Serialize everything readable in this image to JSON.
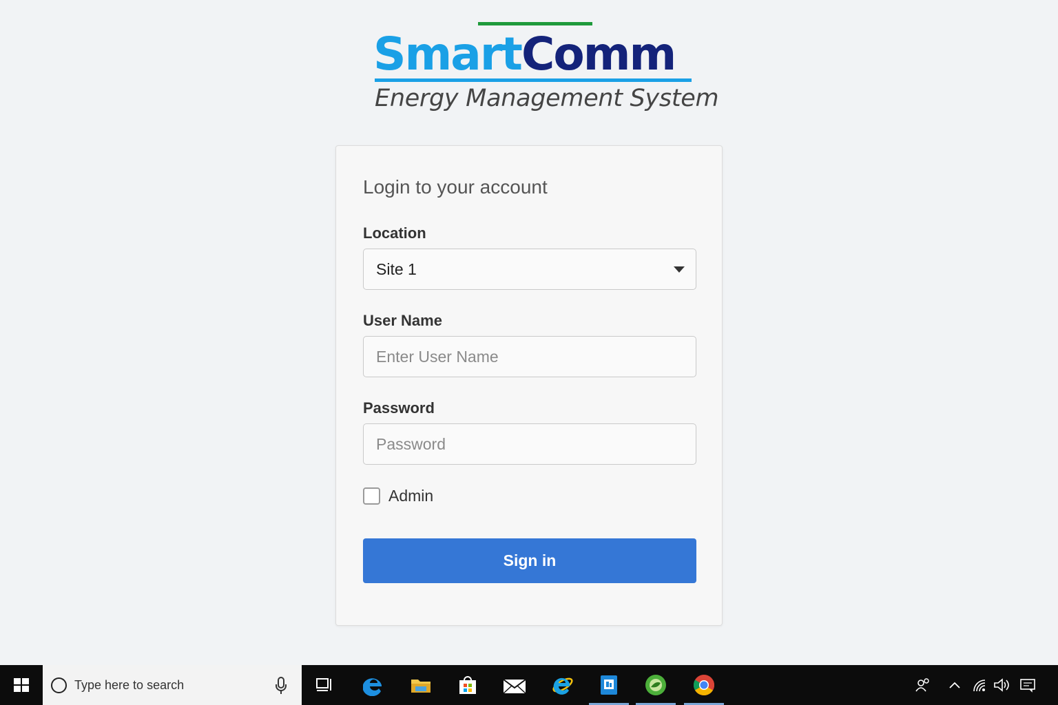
{
  "logo": {
    "brand_part1": "Smart",
    "brand_part2": "Comm",
    "subtitle": "Energy Management System",
    "colors": {
      "primary_blue": "#1aa0e6",
      "navy": "#14237a",
      "green": "#1f9a3b"
    }
  },
  "login": {
    "title": "Login to your account",
    "location_label": "Location",
    "location_value": "Site 1",
    "username_label": "User Name",
    "username_placeholder": "Enter User Name",
    "password_label": "Password",
    "password_placeholder": "Password",
    "admin_label": "Admin",
    "admin_checked": false,
    "signin_label": "Sign in",
    "accent_color": "#3577d6"
  },
  "taskbar": {
    "search_placeholder": "Type here to search",
    "pinned_apps": [
      "task-view-icon",
      "edge-icon",
      "file-explorer-icon",
      "store-icon",
      "mail-icon",
      "internet-explorer-icon",
      "app-icon",
      "green-app-icon",
      "chrome-icon"
    ],
    "tray_icons": [
      "people-icon",
      "chevron-up-icon",
      "wifi-icon",
      "volume-icon",
      "notification-icon"
    ]
  }
}
